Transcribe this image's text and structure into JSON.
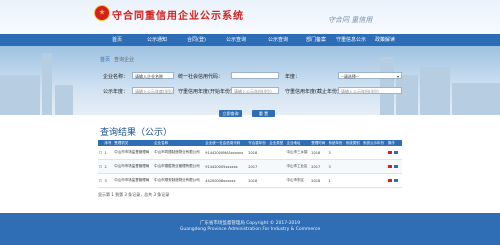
{
  "site": {
    "title": "守合同重信用企业公示系统",
    "slogan": "守合同 重信用",
    "emblem_icon": "national-emblem-icon"
  },
  "nav": {
    "items": [
      "首页",
      "公示通知",
      "合同(登)",
      "公示查询",
      "公示查询",
      "部门备案",
      "守重信息公示",
      "政策解读"
    ]
  },
  "subtabs": {
    "items": [
      "首页",
      "查询企业"
    ]
  },
  "search": {
    "company_name_label": "企业名称：",
    "company_name_value": "请输入企业名称",
    "credit_code_label": "统一社会信用代码：",
    "credit_code_value": "",
    "year_label": "年度：",
    "year_value": "--请选择--",
    "public_year_label": "公示年度：",
    "public_year_placeholder": "请输入公示年度(4位)",
    "start_year_label": "守重信用年度(开始年份)：",
    "start_year_placeholder": "请输入公示年份(4位)",
    "end_year_label": "守重信用年度(截止年份)：",
    "end_year_placeholder": "请输入公示年份(4位)",
    "search_button": "立即查询",
    "reset_button": "重 置"
  },
  "results": {
    "title": "查询结果（公示）",
    "columns": [
      "",
      "序号",
      "受理机关",
      "企业名称",
      "企业统一社会信用代码",
      "守合重年份",
      "企业类型",
      "企业地址",
      "受理时间",
      "系统年份",
      "系统类别",
      "系统公示年份",
      "操作"
    ],
    "rows": [
      [
        "",
        "1",
        "中山市市场监督管理局",
        "中山市同德制造物业有限公司",
        "91442000MA5xxxxxx",
        "2018",
        "",
        "中山市三乡镇",
        "2018",
        "3",
        "",
        "",
        ""
      ],
      [
        "",
        "2",
        "中山市市场监督管理局",
        "中山市德胜物业管理有限公司",
        "914420005xxxxxx",
        "2017",
        "",
        "中山市工业区",
        "2017",
        "3",
        "",
        "",
        ""
      ],
      [
        "",
        "3",
        "中山市市场监督管理局",
        "中山市顺安制造物业有限公司",
        "44200008xxxxxx",
        "2018",
        "",
        "中山市东区",
        "2018",
        "1",
        "",
        "",
        ""
      ]
    ],
    "pager": "显示第 1 到第 3 条记录，总共 3 条记录"
  },
  "footer": {
    "line1": "广东省市场监督管理局 Copyright © 2017-2019",
    "line2": "Guangdong Province Administration For Industry & Commerce"
  }
}
